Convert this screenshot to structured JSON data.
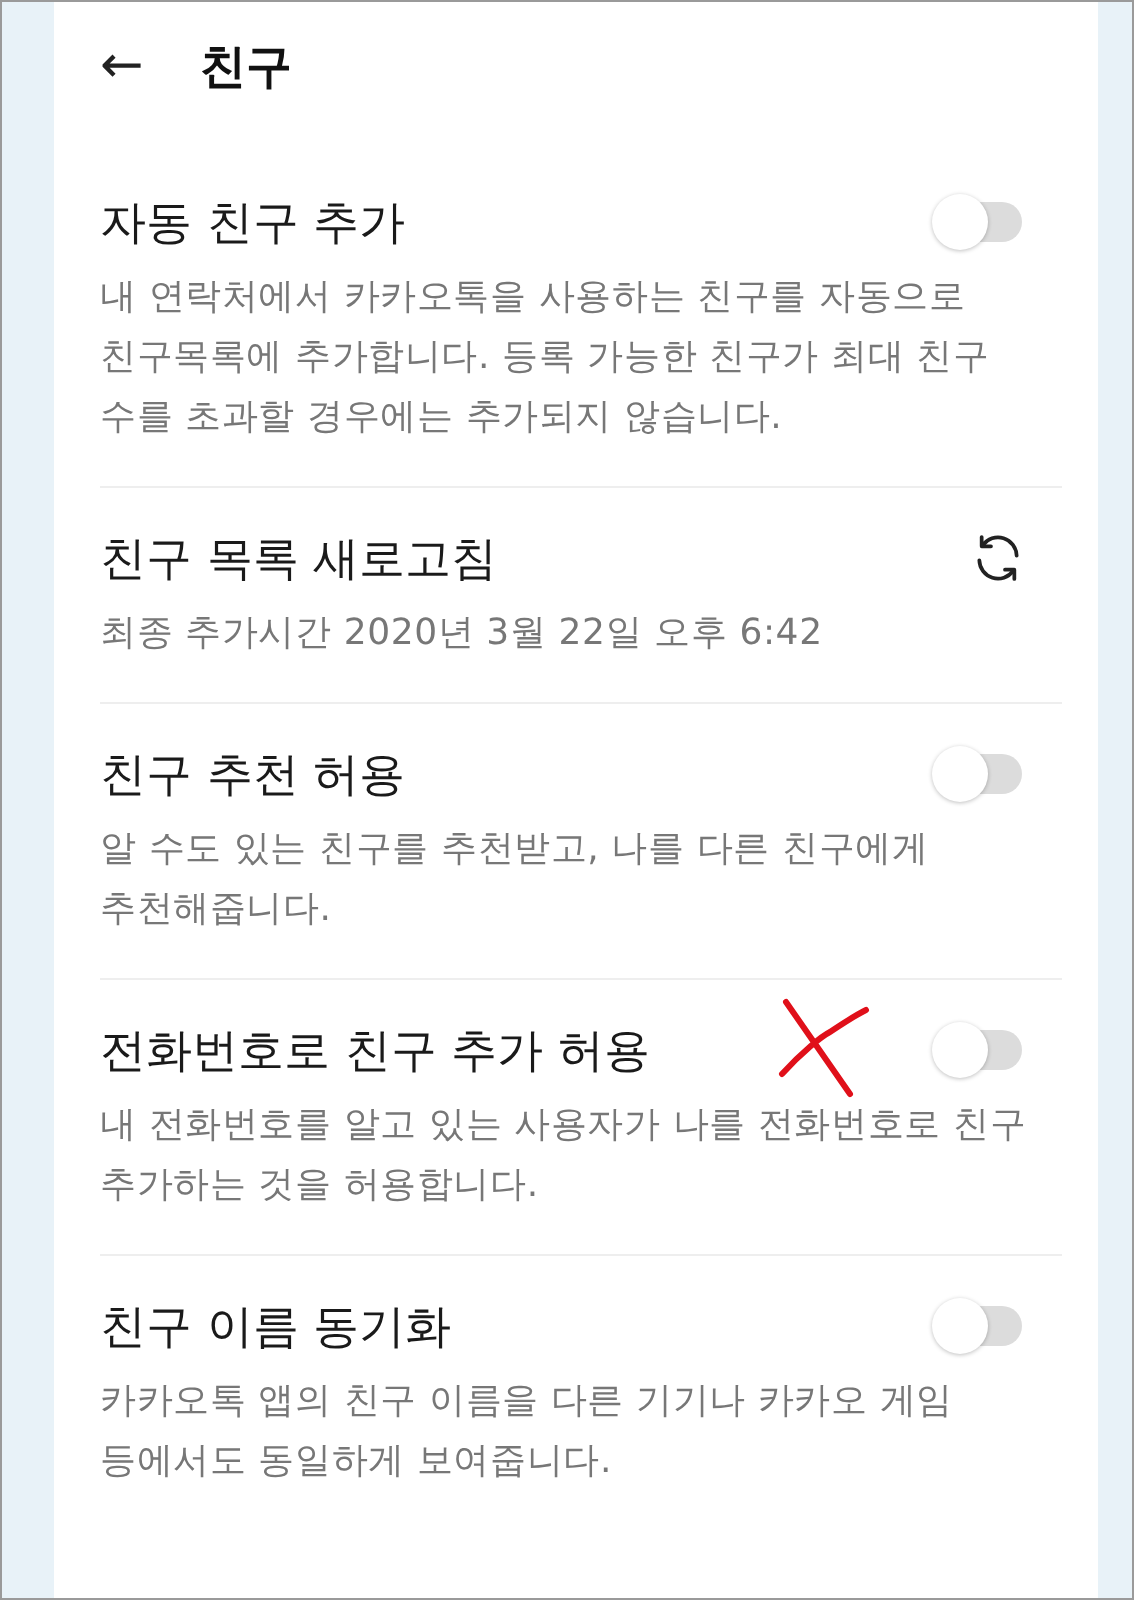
{
  "header": {
    "back_icon": "←",
    "title": "친구"
  },
  "settings": [
    {
      "kind": "toggle",
      "title": "자동 친구 추가",
      "description": "내 연락처에서 카카오톡을 사용하는 친구를 자동으로 친구목록에 추가합니다. 등록 가능한 친구가 최대 친구 수를 초과할 경우에는 추가되지 않습니다.",
      "on": false,
      "crossed_out": false
    },
    {
      "kind": "refresh",
      "title": "친구 목록 새로고침",
      "description": "최종 추가시간 2020년 3월 22일 오후 6:42"
    },
    {
      "kind": "toggle",
      "title": "친구 추천 허용",
      "description": "알 수도 있는 친구를 추천받고, 나를 다른 친구에게 추천해줍니다.",
      "on": false,
      "crossed_out": false
    },
    {
      "kind": "toggle",
      "title": "전화번호로 친구 추가 허용",
      "description": "내 전화번호를 알고 있는 사용자가 나를 전화번호로 친구 추가하는 것을 허용합니다.",
      "on": false,
      "crossed_out": true
    },
    {
      "kind": "toggle",
      "title": "친구 이름 동기화",
      "description": "카카오톡 앱의 친구 이름을 다른 기기나 카카오 게임 등에서도 동일하게 보여줍니다.",
      "on": false,
      "crossed_out": false
    }
  ]
}
